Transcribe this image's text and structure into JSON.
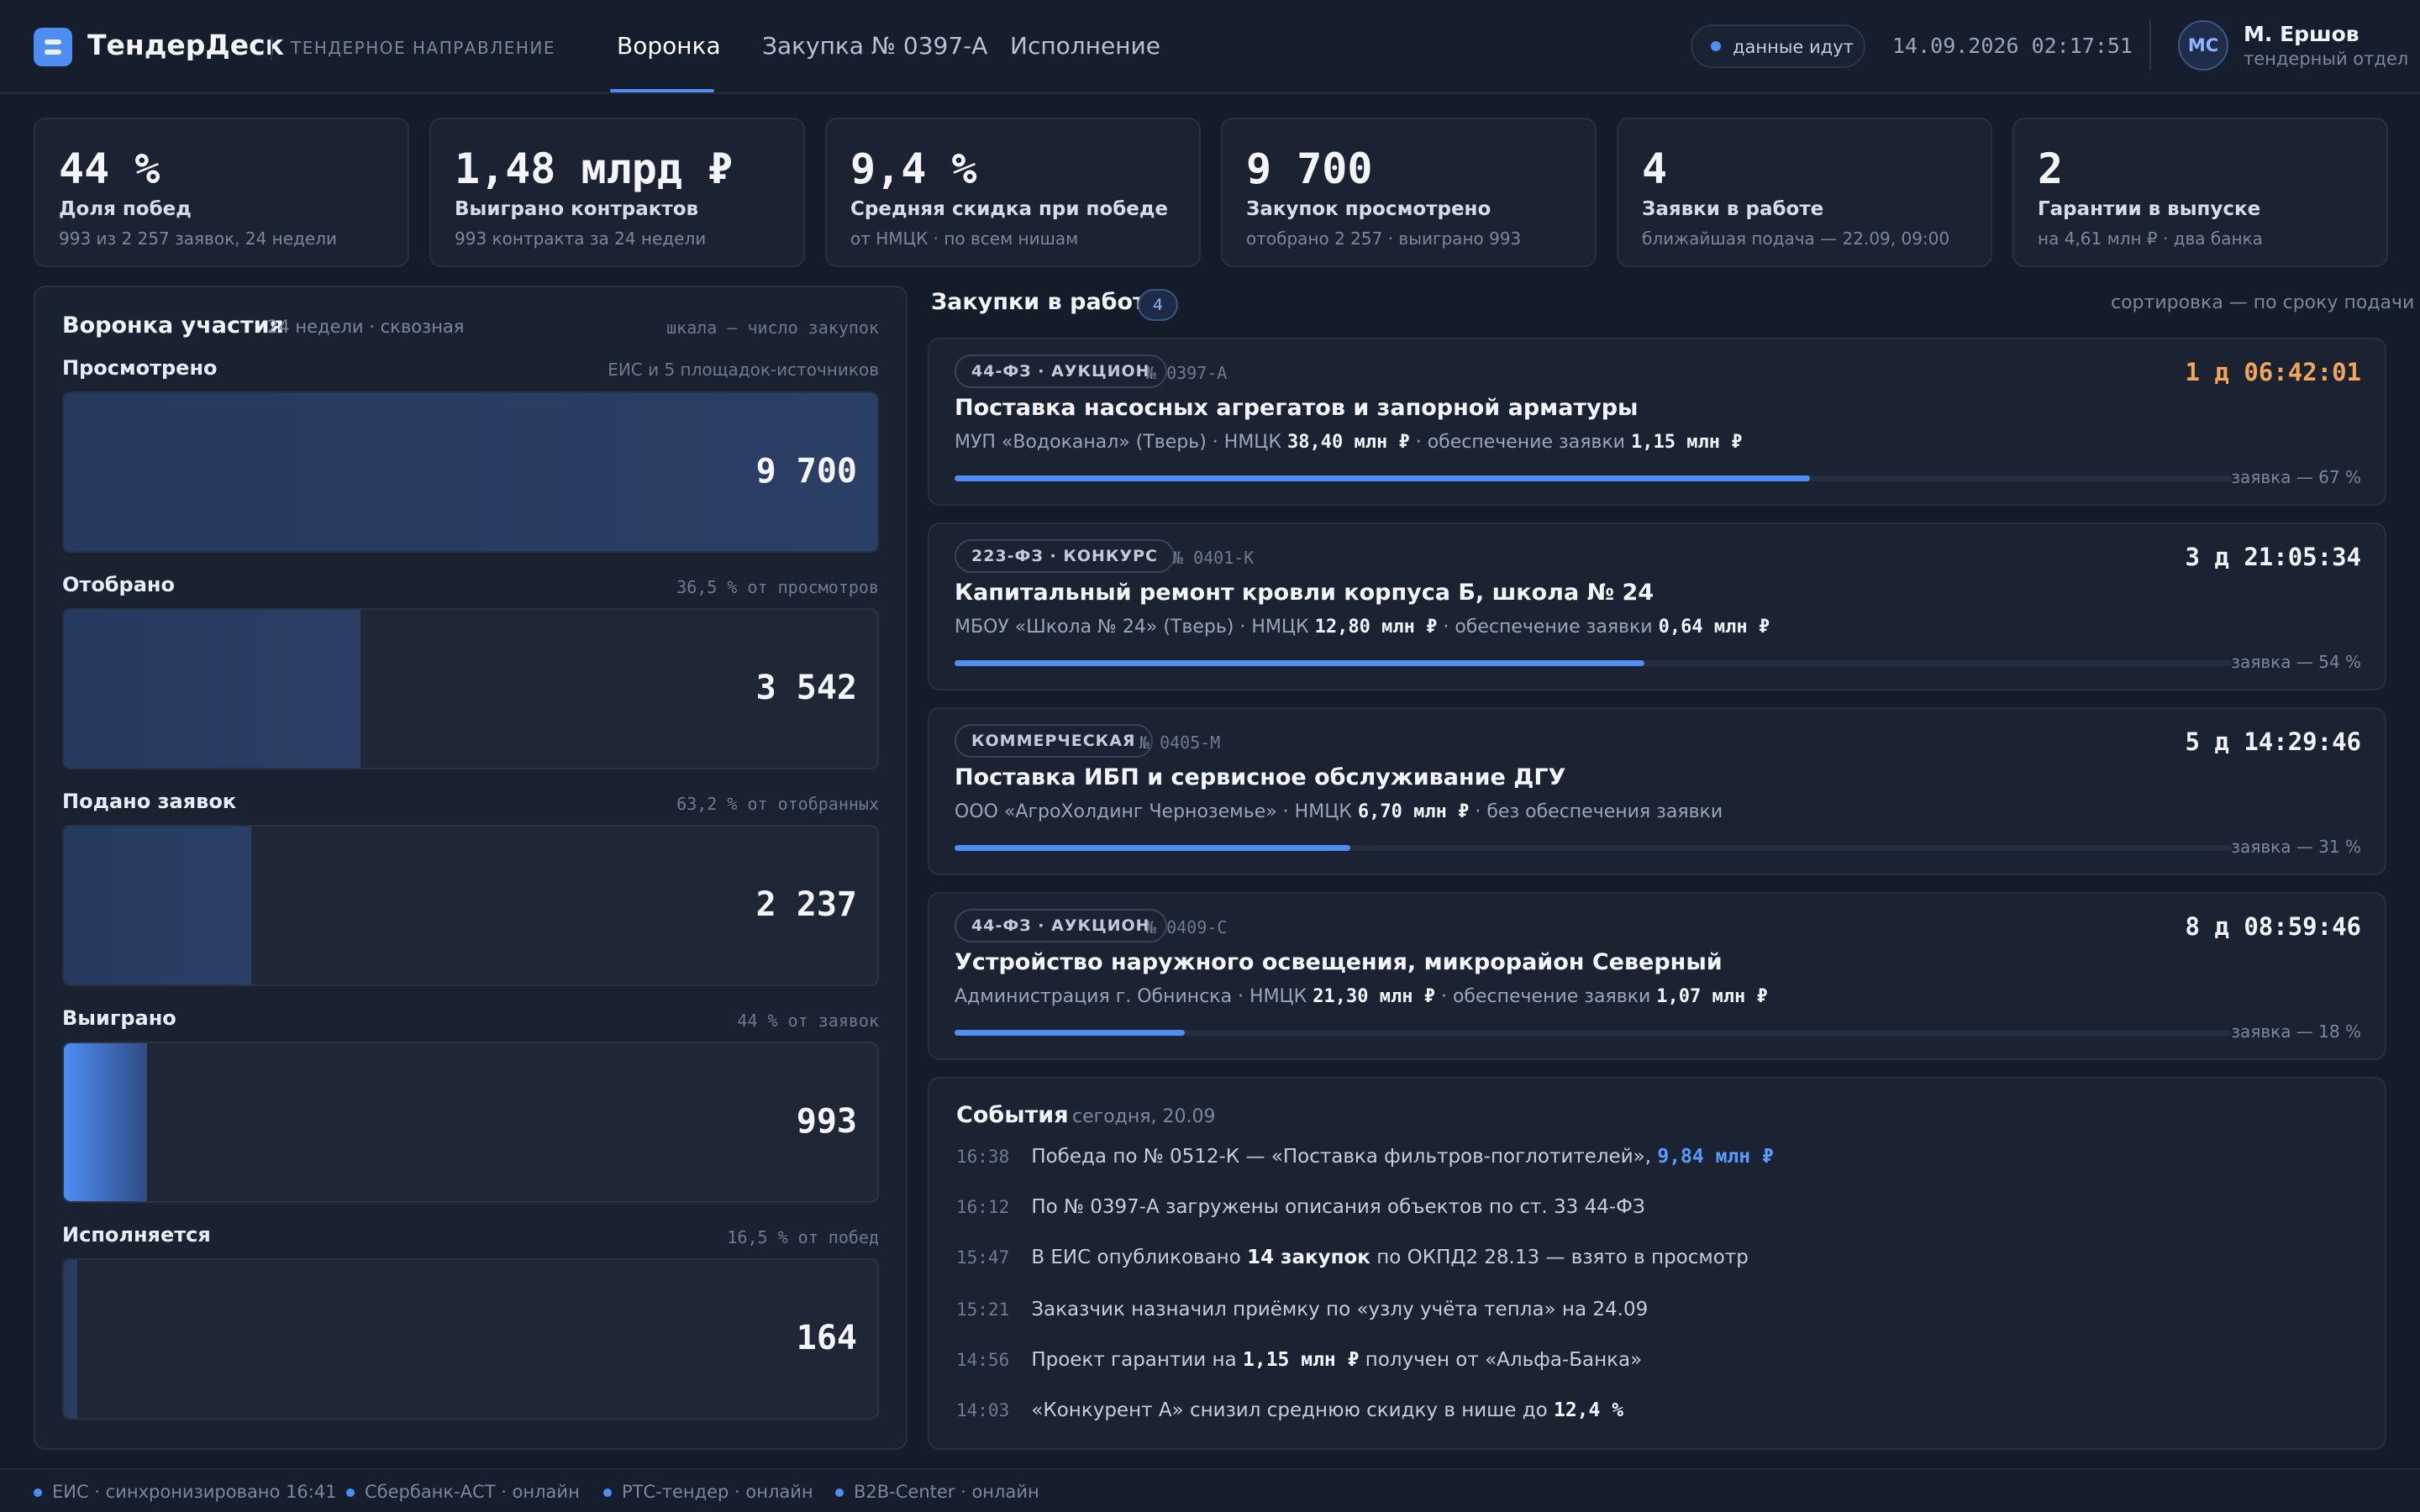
{
  "header": {
    "brand": "ТендерДеск",
    "subtitle": "ТЕНДЕРНОЕ НАПРАВЛЕНИЕ",
    "tabs": [
      {
        "label": "Воронка",
        "active": true
      },
      {
        "label": "Закупка № 0397-А",
        "active": false
      },
      {
        "label": "Исполнение",
        "active": false
      }
    ],
    "live_status": "данные идут",
    "datetime": "14.09.2026 02:17:51",
    "user": {
      "initials": "МС",
      "name": "М. Ершов",
      "role": "тендерный отдел"
    }
  },
  "kpis": [
    {
      "value": "44 %",
      "label": "Доля побед",
      "sub": "993 из 2 257 заявок, 24 недели"
    },
    {
      "value": "1,48 млрд ₽",
      "label": "Выиграно контрактов",
      "sub": "993 контракта за 24 недели"
    },
    {
      "value": "9,4 %",
      "label": "Средняя скидка при победе",
      "sub": "от НМЦК · по всем нишам"
    },
    {
      "value": "9 700",
      "label": "Закупок просмотрено",
      "sub": "отобрано 2 257 · выиграно 993"
    },
    {
      "value": "4",
      "label": "Заявки в работе",
      "sub": "ближайшая подача — 22.09, 09:00"
    },
    {
      "value": "2",
      "label": "Гарантии в выпуске",
      "sub": "на 4,61 млн ₽ · два банка"
    }
  ],
  "funnel": {
    "title": "Воронка участия",
    "subtitle": "24 недели · сквозная",
    "scale_note": "шкала — число закупок",
    "stages": [
      {
        "name": "Просмотрено",
        "note": "ЕИС и 5 площадок-источников",
        "value": "9 700",
        "count": 9700
      },
      {
        "name": "Отобрано",
        "note": "36,5 % от просмотров",
        "value": "3 542",
        "count": 3542
      },
      {
        "name": "Подано заявок",
        "note": "63,2 % от отобранных",
        "value": "2 237",
        "count": 2237
      },
      {
        "name": "Выиграно",
        "note": "44 % от заявок",
        "value": "993",
        "count": 993
      },
      {
        "name": "Исполняется",
        "note": "16,5 % от побед",
        "value": "164",
        "count": 164
      }
    ]
  },
  "procurements": {
    "title": "Закупки в работе",
    "count": "4",
    "sort_note": "сортировка — по сроку подачи",
    "items": [
      {
        "tag": "44-ФЗ · АУКЦИОН",
        "number": "№ 0397-А",
        "time_left": "1 д 06:42:01",
        "title": "Поставка насосных агрегатов и запорной арматуры",
        "customer": "МУП «Водоканал» (Тверь) · НМЦК",
        "nmck": "38,40 млн ₽",
        "security_label": "· обеспечение заявки",
        "security": "1,15 млн ₽",
        "progress": 0.67,
        "progress_label": "заявка — 67 %"
      },
      {
        "tag": "223-ФЗ · КОНКУРС",
        "number": "№ 0401-К",
        "time_left": "3 д 21:05:34",
        "title": "Капитальный ремонт кровли корпуса Б, школа № 24",
        "customer": "МБОУ «Школа № 24» (Тверь) · НМЦК",
        "nmck": "12,80 млн ₽",
        "security_label": "· обеспечение заявки",
        "security": "0,64 млн ₽",
        "progress": 0.54,
        "progress_label": "заявка — 54 %"
      },
      {
        "tag": "КОММЕРЧЕСКАЯ",
        "number": "№ 0405-М",
        "time_left": "5 д 14:29:46",
        "title": "Поставка ИБП и сервисное обслуживание ДГУ",
        "customer": "ООО «АгроХолдинг Черноземье» · НМЦК",
        "nmck": "6,70 млн ₽",
        "security_label": "· без обеспечения заявки",
        "security": "",
        "progress": 0.31,
        "progress_label": "заявка — 31 %"
      },
      {
        "tag": "44-ФЗ · АУКЦИОН",
        "number": "№ 0409-С",
        "time_left": "8 д 08:59:46",
        "title": "Устройство наружного освещения, микрорайон Северный",
        "customer": "Администрация г. Обнинска · НМЦК",
        "nmck": "21,30 млн ₽",
        "security_label": "· обеспечение заявки",
        "security": "1,07 млн ₽",
        "progress": 0.18,
        "progress_label": "заявка — 18 %"
      }
    ]
  },
  "events": {
    "title": "События",
    "date": "сегодня, 20.09",
    "items": [
      {
        "time": "16:38",
        "pre": "Победа по № 0512-К — «Поставка фильтров-поглотителей»,",
        "bold": "9,84 млн ₽",
        "post": ""
      },
      {
        "time": "16:12",
        "pre": "По № 0397-А загружены описания объектов по ст. 33 44-ФЗ",
        "bold": "",
        "post": ""
      },
      {
        "time": "15:47",
        "pre": "В ЕИС опубликовано",
        "bold": "14 закупок",
        "post": "по ОКПД2 28.13 — взято в просмотр"
      },
      {
        "time": "15:21",
        "pre": "Заказчик назначил приёмку по «узлу учёта тепла» на 24.09",
        "bold": "",
        "post": ""
      },
      {
        "time": "14:56",
        "pre": "Проект гарантии на",
        "bold": "1,15 млн ₽",
        "post": "получен от «Альфа-Банка»"
      },
      {
        "time": "14:03",
        "pre": "«Конкурент А» снизил среднюю скидку в нише до",
        "bold": "12,4 %",
        "post": ""
      }
    ]
  },
  "footer": {
    "items": [
      "ЕИС · синхронизировано 16:41",
      "Сбербанк-АСТ · онлайн",
      "РТС-тендер · онлайн",
      "B2B-Center · онлайн"
    ]
  },
  "colors": {
    "accent": "#4f8df2",
    "urgent": "#f2a65a",
    "background": "#141b29",
    "panel": "#1b2333"
  }
}
